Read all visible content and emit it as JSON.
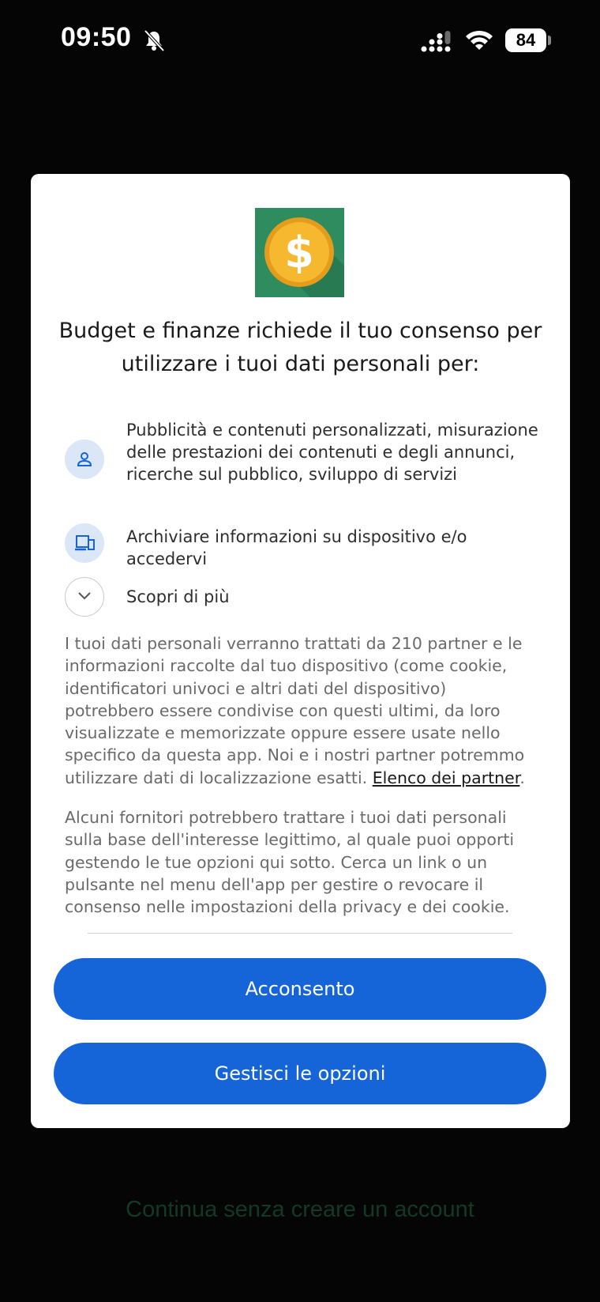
{
  "status_bar": {
    "time": "09:50",
    "battery": "84",
    "icons": [
      "bell-slash-icon",
      "signal-icon",
      "wifi-icon",
      "battery-icon"
    ]
  },
  "dialog": {
    "logo_icon": "dollar-coin-icon",
    "title": "Budget e finanze richiede il tuo consenso per utilizzare i tuoi dati personali per:",
    "purposes": [
      {
        "icon": "person-icon",
        "text": "Pubblicità e contenuti personalizzati, misurazione delle prestazioni dei contenuti e degli annunci, ricerche sul pubblico, sviluppo di servizi"
      },
      {
        "icon": "devices-icon",
        "text": "Archiviare informazioni su dispositivo e/o accedervi"
      }
    ],
    "learn_more": "Scopri di più",
    "paragraph1": "I tuoi dati personali verranno trattati da 210 partner e le informazioni raccolte dal tuo dispositivo (come cookie, identificatori univoci e altri dati del dispositivo) potrebbero essere condivise con questi ultimi, da loro visualizzate e memorizzate oppure essere usate nello specifico da questa app. Noi e i nostri partner potremmo utilizzare dati di localizzazione esatti.",
    "partner_link": "Elenco dei partner",
    "partner_link_suffix": ".",
    "paragraph2": "Alcuni fornitori potrebbero trattare i tuoi dati personali sulla base dell'interesse legittimo, al quale puoi opporti gestendo le tue opzioni qui sotto. Cerca un link o un pulsante nel menu dell'app per gestire o revocare il consenso nelle impostazioni della privacy e dei cookie.",
    "consent_button": "Acconsento",
    "manage_button": "Gestisci le opzioni"
  },
  "background": {
    "continue_link": "Continua senza creare un account"
  },
  "colors": {
    "accent": "#1565d8",
    "icon_bg": "#dbe6f7",
    "logo_bg": "#2e8c5f",
    "coin": "#f5b82e"
  }
}
